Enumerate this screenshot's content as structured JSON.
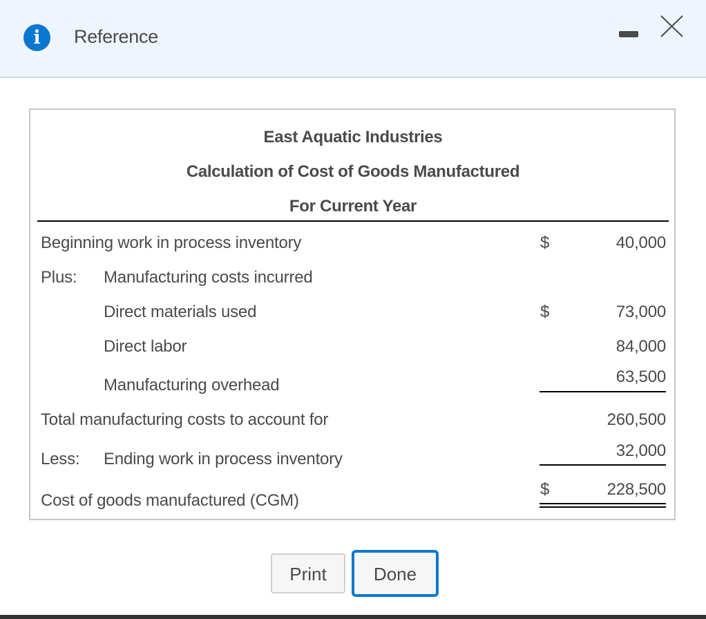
{
  "dialog": {
    "title": "Reference",
    "icons": {
      "info": "info-icon",
      "minimize": "minimize-icon",
      "close": "close-icon"
    },
    "accent_color": "#0b78d0"
  },
  "statement": {
    "company": "East Aquatic Industries",
    "title": "Calculation of Cost of Goods Manufactured",
    "period": "For Current Year",
    "rows": [
      {
        "prefix": "",
        "label": "Beginning work in process inventory",
        "currency": "$",
        "amount": "40,000"
      },
      {
        "prefix": "Plus:",
        "label": "Manufacturing costs incurred",
        "currency": "",
        "amount": ""
      },
      {
        "prefix": "",
        "label": "Direct materials used",
        "currency": "$",
        "amount": "73,000"
      },
      {
        "prefix": "",
        "label": "Direct labor",
        "currency": "",
        "amount": "84,000"
      },
      {
        "prefix": "",
        "label": "Manufacturing overhead",
        "currency": "",
        "amount": "63,500"
      },
      {
        "prefix": "",
        "label": "Total manufacturing costs to account for",
        "currency": "",
        "amount": "260,500"
      },
      {
        "prefix": "Less:",
        "label": "Ending work in process inventory",
        "currency": "",
        "amount": "32,000"
      },
      {
        "prefix": "",
        "label": "Cost of goods manufactured (CGM)",
        "currency": "$",
        "amount": "228,500"
      }
    ]
  },
  "buttons": {
    "print": "Print",
    "done": "Done"
  }
}
